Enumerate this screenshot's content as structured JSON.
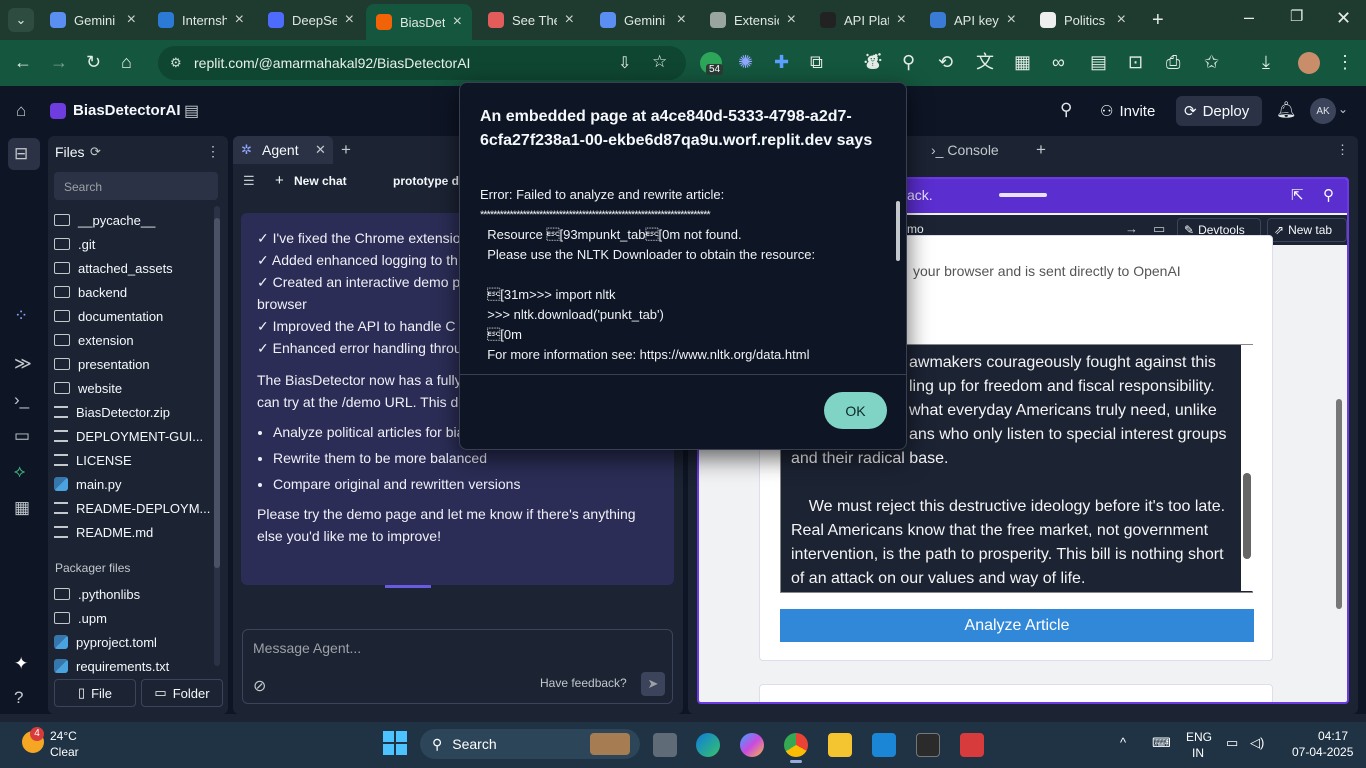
{
  "browser": {
    "tabs": [
      {
        "label": "Gemini",
        "color": "#5a8ef0"
      },
      {
        "label": "Internsh",
        "color": "#2b7bd6"
      },
      {
        "label": "DeepSe",
        "color": "#4d6bfe"
      },
      {
        "label": "BiasDet",
        "color": "#f26207"
      },
      {
        "label": "See The",
        "color": "#e25c5c"
      },
      {
        "label": "Gemini",
        "color": "#5a8ef0"
      },
      {
        "label": "Extensio",
        "color": "#9aa5a0"
      },
      {
        "label": "API Plat",
        "color": "#222"
      },
      {
        "label": "API key",
        "color": "#3a7bd5"
      },
      {
        "label": "Politics",
        "color": "#eee"
      }
    ],
    "url": "replit.com/@amarmahakal92/BiasDetectorAI",
    "extension_badge": "54"
  },
  "replit": {
    "project_name": "BiasDetectorAI",
    "invite_label": "Invite",
    "deploy_label": "Deploy",
    "avatar_initials": "AK"
  },
  "files": {
    "title": "Files",
    "search_placeholder": "Search",
    "items": [
      "__pycache__",
      ".git",
      "attached_assets",
      "backend",
      "documentation",
      "extension",
      "presentation",
      "website",
      "BiasDetector.zip",
      "DEPLOYMENT-GUI...",
      "LICENSE",
      "main.py",
      "README-DEPLOYM...",
      "README.md"
    ],
    "packager_title": "Packager files",
    "packager_items": [
      ".pythonlibs",
      ".upm",
      "pyproject.toml",
      "requirements.txt"
    ],
    "file_button": "File",
    "folder_button": "Folder"
  },
  "agent": {
    "tab_label": "Agent",
    "new_chat": "New chat",
    "chat_title": "prototype d",
    "checks": [
      "I've fixed the Chrome extensio",
      "Added enhanced logging to th",
      "Created an interactive demo p",
      "browser",
      "Improved the API to handle C",
      "Enhanced error handling throu"
    ],
    "para1": "The BiasDetector now has a fully",
    "para1b": "can try at the /demo URL. This d",
    "bullets": [
      "Analyze political articles for bias",
      "Rewrite them to be more balanced",
      "Compare original and rewritten versions"
    ],
    "closing": "Please try the demo page and let me know if there's anything else you'd like me to improve!",
    "message_placeholder": "Message Agent...",
    "feedback": "Have feedback?"
  },
  "right": {
    "console_tab": "Console",
    "webview_banner": "ack.",
    "webview_url": "mo",
    "devtools": "Devtools",
    "new_tab": "New tab",
    "notice": "your browser and is sent directly to OpenAI",
    "article_text": [
      "awmakers courageously fought against this",
      "ling up for freedom and fiscal responsibility.",
      "what everyday Americans truly need, unlike",
      "ans who only listen to special interest groups",
      "and their radical base.",
      "",
      "    We must reject this destructive ideology before it's too late.",
      "Real Americans know that the free market, not government",
      "intervention, is the path to prosperity. This bill is nothing short",
      "of an attack on our values and way of life."
    ],
    "analyze_button": "Analyze Article"
  },
  "dialog": {
    "title": "An embedded page at a4ce840d-5333-4798-a2d7-6cfa27f238a1-00-ekbe6d87qa9u.worf.replit.dev says",
    "error_line": "Error: Failed to analyze and rewrite article:",
    "stars": "**********************************************************************",
    "lines": [
      "  Resource \u001b[93mpunkt_tab\u001b[0m not found.",
      "  Please use the NLTK Downloader to obtain the resource:",
      "",
      "  \u001b[31m>>> import nltk",
      "  >>> nltk.download('punkt_tab')",
      "  \u001b[0m",
      "  For more information see: https://www.nltk.org/data.html"
    ],
    "ok_label": "OK"
  },
  "taskbar": {
    "weather_temp": "24°C",
    "weather_desc": "Clear",
    "weather_badge": "4",
    "search_label": "Search",
    "lang_top": "ENG",
    "lang_bottom": "IN",
    "time": "04:17",
    "date": "07-04-2025"
  }
}
